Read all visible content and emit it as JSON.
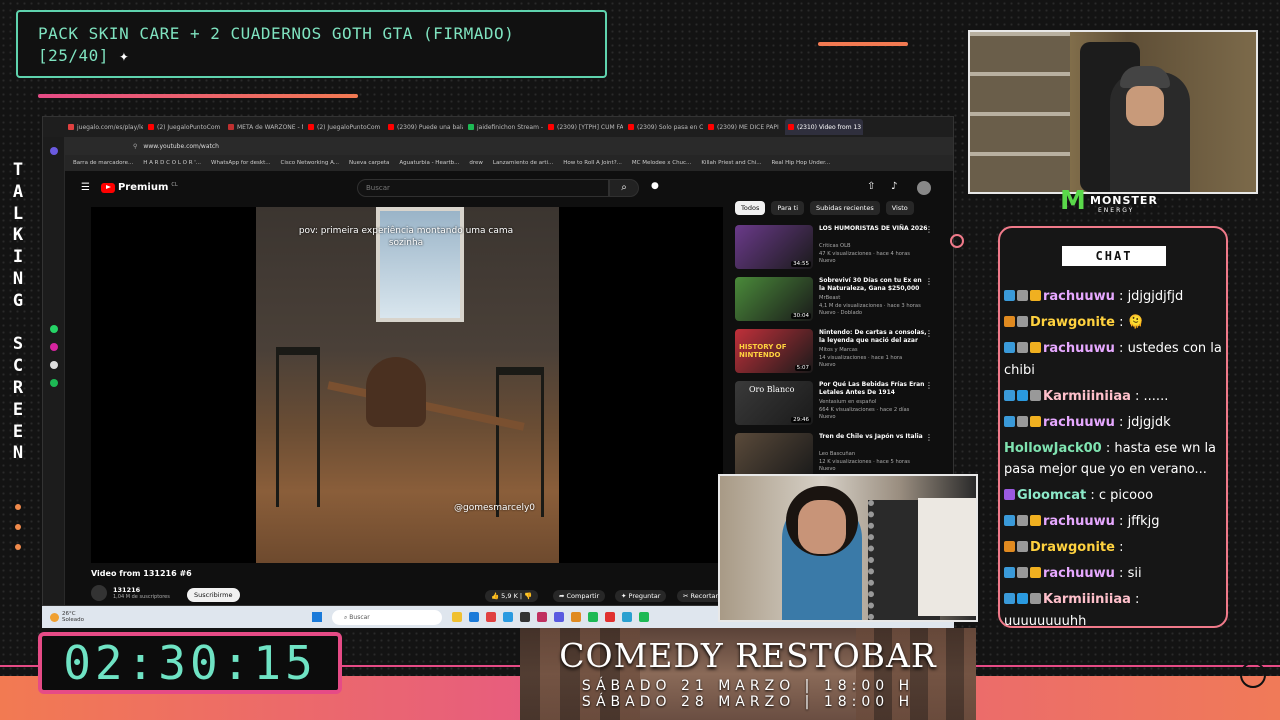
{
  "goal": {
    "line1": "PACK SKIN CARE + 2 CUADERNOS GOTH GTA (FIRMADO)",
    "line2": "[25/40]"
  },
  "side_text": "TALKING SCREEN",
  "browser": {
    "tabs": [
      "juegalo.com/es/play/lee",
      "(2) JuegaloPuntoCom",
      "META de WARZONE - M",
      "(2) JuegaloPuntoCom",
      "(2309) Puede una bala s",
      "jaidefinichon Stream - W",
      "(2309) [YTPH] CUM FALC",
      "(2309) Solo pasa en Chile",
      "(2309) ME DICE PAPI",
      "(2310) Video from 13"
    ],
    "url": "www.youtube.com/watch",
    "bookmarks": [
      "Barra de marcadore...",
      "H A R D C O L O R '...",
      "WhatsApp for deskt...",
      "Cisco Networking A...",
      "Nueva carpeta",
      "Aguaturbia - Heartb...",
      "drew",
      "Lanzamiento de arti...",
      "How to Roll A Joint?...",
      "MC Melodee x Chuc...",
      "Killah Priest and Chi...",
      "Real Hip Hop Under..."
    ]
  },
  "youtube": {
    "logo": "Premium",
    "logo_region": "CL",
    "search_placeholder": "Buscar",
    "video_caption": "pov: primeira experiência montando uma cama sozinha",
    "video_handle": "@gomesmarcely0",
    "video_title": "Video from 131216 #6",
    "channel": "131216",
    "subscribers": "1,04 M de suscriptores",
    "subscribe": "Suscribirme",
    "likes": "5,9 K",
    "share": "Compartir",
    "ask": "Preguntar",
    "clip": "Recortar",
    "chips": [
      "Todos",
      "Para ti",
      "Subidas recientes",
      "Visto"
    ],
    "recommendations": [
      {
        "title": "LOS HUMORISTAS DE VIÑA 2026",
        "channel": "Criticas OLB",
        "meta": "47 K visualizaciones · hace 4 horas",
        "badge": "Nuevo",
        "duration": "34:55",
        "color": "#6a3a8a"
      },
      {
        "title": "Sobreviví 30 Días con tu Ex en la Naturaleza, Gana $250,000",
        "channel": "MrBeast",
        "meta": "4,1 M de visualizaciones · hace 3 horas",
        "badge": "Nuevo · Doblado",
        "duration": "30:04",
        "color": "#4a8a3a"
      },
      {
        "title": "Nintendo: De cartas a consolas, la leyenda que nació del azar",
        "channel": "Mitos y Marcas",
        "meta": "14 visualizaciones · hace 1 hora",
        "badge": "Nuevo",
        "duration": "5:07",
        "color": "#c0303a"
      },
      {
        "title": "Por Qué Las Bebidas Frías Eran Letales Antes De 1914",
        "channel": "Ventasium en español",
        "meta": "664 K visualizaciones · hace 2 días",
        "badge": "Nuevo",
        "duration": "29:46",
        "color": "#3a3a3a"
      },
      {
        "title": "Tren de Chile vs Japón vs Italia",
        "channel": "Leo Bascuñan",
        "meta": "12 K visualizaciones · hace 5 horas",
        "badge": "Nuevo",
        "duration": "",
        "color": "#5a4a3a"
      }
    ],
    "rec3_thumb_text": "HISTORY OF NINTENDO",
    "rec4_thumb_text": "Oro Blanco"
  },
  "taskbar": {
    "temp": "26°C",
    "weather": "Soleado",
    "search": "Buscar"
  },
  "chat": {
    "title": "CHAT",
    "messages": [
      {
        "user": "rachuuwu",
        "text": ": jdjgjdjfjd",
        "color": "#e6a8ff",
        "badges": [
          "#3a9ad9",
          "#999",
          "#f0b020"
        ]
      },
      {
        "user": "Drawgonite",
        "text": ": 🫠",
        "color": "#ffd23f",
        "badges": [
          "#e08a20",
          "#999"
        ]
      },
      {
        "user": "rachuuwu",
        "text": ": ustedes con la chibi",
        "color": "#e6a8ff",
        "badges": [
          "#3a9ad9",
          "#999",
          "#f0b020"
        ]
      },
      {
        "user": "Karmiiiniiaa",
        "text": ": ......",
        "color": "#ffc0cb",
        "badges": [
          "#3a9ad9",
          "#2a9ae0",
          "#999"
        ]
      },
      {
        "user": "rachuuwu",
        "text": ": jdjgjdk",
        "color": "#e6a8ff",
        "badges": [
          "#3a9ad9",
          "#999",
          "#f0b020"
        ]
      },
      {
        "user": "HollowJack00",
        "text": ": hasta ese wn la pasa mejor que yo en verano...",
        "color": "#7fe3b0",
        "badges": []
      },
      {
        "user": "Gloomcat",
        "text": ": c picooo",
        "color": "#8ce9c9",
        "badges": [
          "#9a5ae0"
        ]
      },
      {
        "user": "rachuuwu",
        "text": ": jffkjg",
        "color": "#e6a8ff",
        "badges": [
          "#3a9ad9",
          "#999",
          "#f0b020"
        ]
      },
      {
        "user": "Drawgonite",
        "text": ":",
        "color": "#ffd23f",
        "badges": [
          "#e08a20",
          "#999"
        ]
      },
      {
        "user": "rachuuwu",
        "text": ": sii",
        "color": "#e6a8ff",
        "badges": [
          "#3a9ad9",
          "#999",
          "#f0b020"
        ]
      },
      {
        "user": "Karmiiiniiaa",
        "text": ": uuuuuuuuhh",
        "color": "#ffc0cb",
        "badges": [
          "#3a9ad9",
          "#2a9ae0",
          "#999"
        ]
      }
    ]
  },
  "sponsor": {
    "name": "MONSTER",
    "sub": "ENERGY"
  },
  "timer": "02:30:15",
  "ad": {
    "title": "COMEDY RESTOBAR",
    "date1": "SÁBADO 21 MARZO | 18:00 H",
    "date2": "SÁBADO 28 MARZO | 18:00 H"
  },
  "colors": {
    "accent_green": "#5fd3ae",
    "accent_pink": "#e64b86",
    "accent_orange": "#f27a52"
  }
}
